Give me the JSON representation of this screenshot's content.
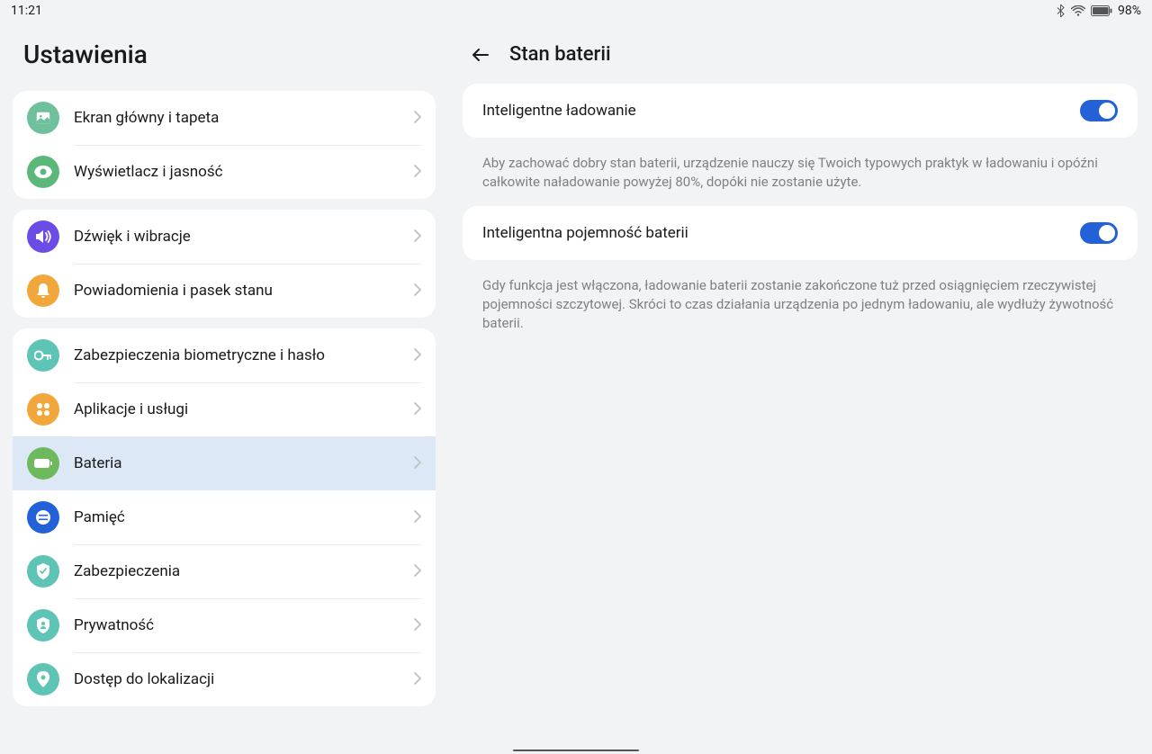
{
  "status": {
    "time": "11:21",
    "battery": "98%"
  },
  "sidebar": {
    "title": "Ustawienia",
    "groups": [
      {
        "items": [
          {
            "label": "Ekran główny i tapeta",
            "icon": "image-icon",
            "color": "#6fc19e"
          },
          {
            "label": "Wyświetlacz i jasność",
            "icon": "eye-icon",
            "color": "#5bb87a"
          }
        ]
      },
      {
        "items": [
          {
            "label": "Dźwięk i wibracje",
            "icon": "volume-icon",
            "color": "#6b4de6"
          },
          {
            "label": "Powiadomienia i pasek stanu",
            "icon": "bell-icon",
            "color": "#f2a73c"
          }
        ]
      },
      {
        "items": [
          {
            "label": "Zabezpieczenia biometryczne i hasło",
            "icon": "key-icon",
            "color": "#5ec4b5"
          },
          {
            "label": "Aplikacje i usługi",
            "icon": "apps-icon",
            "color": "#f2a73c"
          },
          {
            "label": "Bateria",
            "icon": "battery-icon",
            "color": "#6eb85e",
            "selected": true
          },
          {
            "label": "Pamięć",
            "icon": "storage-icon",
            "color": "#2261d8"
          },
          {
            "label": "Zabezpieczenia",
            "icon": "shield-icon",
            "color": "#5ec4b5"
          },
          {
            "label": "Prywatność",
            "icon": "privacy-icon",
            "color": "#5ec4b5"
          },
          {
            "label": "Dostęp do lokalizacji",
            "icon": "location-icon",
            "color": "#5ec4b5"
          }
        ]
      }
    ]
  },
  "content": {
    "title": "Stan baterii",
    "options": [
      {
        "label": "Inteligentne ładowanie",
        "enabled": true,
        "description": "Aby zachować dobry stan baterii, urządzenie nauczy się Twoich typowych praktyk w ładowaniu i opóźni całkowite naładowanie powyżej 80%, dopóki nie zostanie użyte."
      },
      {
        "label": "Inteligentna pojemność baterii",
        "enabled": true,
        "description": "Gdy funkcja jest włączona, ładowanie baterii zostanie zakończone tuż przed osiągnięciem rzeczywistej pojemności szczytowej. Skróci to czas działania urządzenia po jednym ładowaniu, ale wydłuży żywotność baterii."
      }
    ]
  }
}
